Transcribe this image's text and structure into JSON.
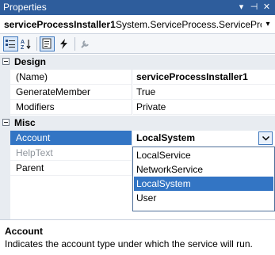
{
  "window": {
    "title": "Properties",
    "buttons": {
      "pin": "▾",
      "autohide": "⊣",
      "close": "✕"
    }
  },
  "object_selector": {
    "name": "serviceProcessInstaller1",
    "type": "System.ServiceProcess.ServiceProce",
    "dropdown_icon": "chevron-down-icon"
  },
  "toolbar": {
    "items": [
      {
        "name": "categorized",
        "icon": "categorized-icon",
        "active": true
      },
      {
        "name": "alphabetical",
        "icon": "alphabetical-icon",
        "active": false
      },
      {
        "name": "properties",
        "icon": "properties-icon",
        "active": true
      },
      {
        "name": "events",
        "icon": "lightning-icon",
        "active": false
      },
      {
        "name": "property-pages",
        "icon": "wrench-icon",
        "active": false
      }
    ]
  },
  "grid": {
    "categories": [
      {
        "label": "Design",
        "properties": [
          {
            "name": "(Name)",
            "value": "serviceProcessInstaller1",
            "bold": true
          },
          {
            "name": "GenerateMember",
            "value": "True"
          },
          {
            "name": "Modifiers",
            "value": "Private"
          }
        ]
      },
      {
        "label": "Misc",
        "properties": [
          {
            "name": "Account",
            "value": "LocalSystem",
            "bold": true,
            "selected": true
          },
          {
            "name": "HelpText",
            "value": "",
            "disabled": true
          },
          {
            "name": "Parent",
            "value": ""
          }
        ]
      }
    ]
  },
  "dropdown": {
    "options": [
      "LocalService",
      "NetworkService",
      "LocalSystem",
      "User"
    ],
    "selected": "LocalSystem"
  },
  "description": {
    "title": "Account",
    "text": "Indicates the account type under which the service will run."
  },
  "colors": {
    "titlebar": "#2e5d9c",
    "selection": "#3375c4",
    "category_bg": "#e8ecf1"
  }
}
